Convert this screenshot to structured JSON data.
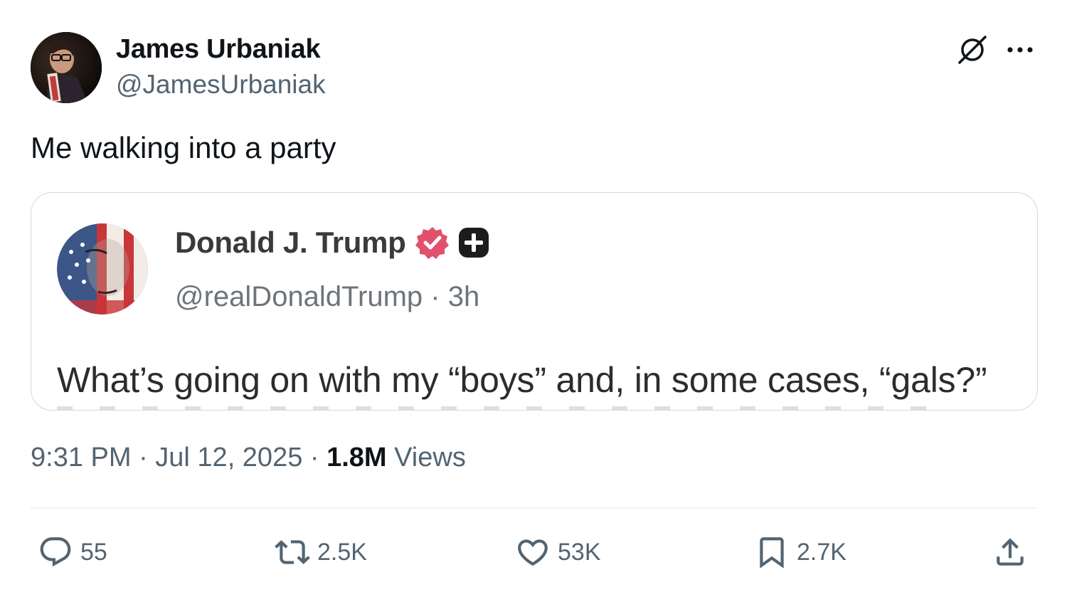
{
  "tweet": {
    "author_name": "James Urbaniak",
    "author_handle": "@JamesUrbaniak",
    "text": "Me walking into a party",
    "timestamp": "9:31 PM · Jul 12, 2025 · ",
    "views_count": "1.8M",
    "views_label": " Views"
  },
  "quoted": {
    "name": "Donald J. Trump",
    "handle_time": "@realDonaldTrump · 3h",
    "text": "What’s going on with my “boys” and, in some cases, “gals?”"
  },
  "actions": {
    "replies": "55",
    "reposts": "2.5K",
    "likes": "53K",
    "bookmarks": "2.7K"
  },
  "icons": {
    "header": [
      "grok-icon",
      "more-icon"
    ],
    "actions": [
      "reply-icon",
      "repost-icon",
      "like-icon",
      "bookmark-icon",
      "share-icon"
    ],
    "badges": [
      "verified-badge-icon",
      "plus-badge-icon"
    ]
  },
  "colors": {
    "text": "#0f1419",
    "secondary": "#536471",
    "border": "#cfd9de",
    "verified_badge": "#e2506c"
  }
}
